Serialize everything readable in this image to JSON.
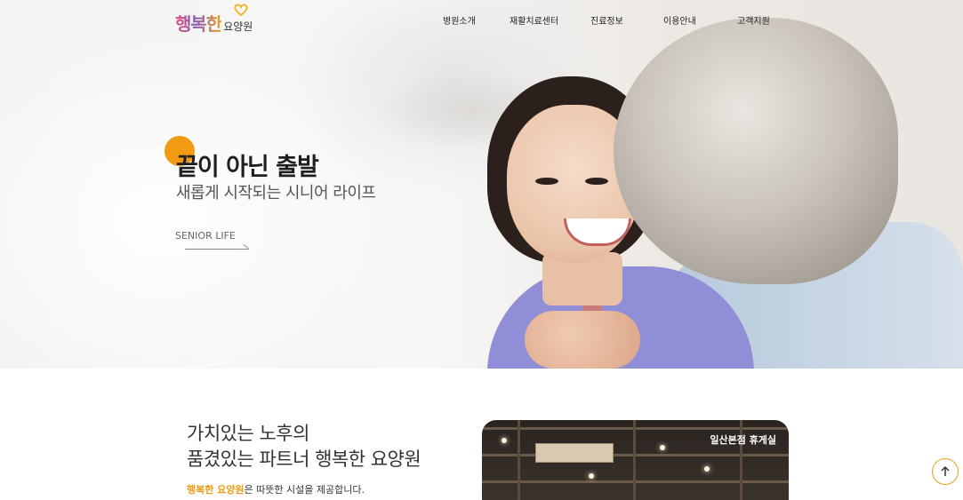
{
  "logo": {
    "mark": "행복한",
    "sub": "요양원"
  },
  "nav": {
    "items": [
      {
        "label": "병원소개"
      },
      {
        "label": "재활치료센터"
      },
      {
        "label": "진료정보"
      },
      {
        "label": "이용안내"
      },
      {
        "label": "고객지원"
      }
    ]
  },
  "hero": {
    "title": "끝이 아닌 출발",
    "subtitle": "새롭게 시작되는 시니어 라이프",
    "link_label": "SENIOR LIFE"
  },
  "intro": {
    "title_line1": "가치있는 노후의",
    "title_line2": "품겼있는 파트너 행복한 요양원",
    "desc_highlight": "행복한 요양원",
    "desc_rest": "은 따뜻한 시설을 제공합니다."
  },
  "photo": {
    "caption": "일산본점 휴게실"
  },
  "icons": {
    "scroll_top": "arrow-up-icon",
    "logo_heart": "heart-icon"
  },
  "colors": {
    "accent": "#f29b12",
    "nav_text": "#222222"
  }
}
